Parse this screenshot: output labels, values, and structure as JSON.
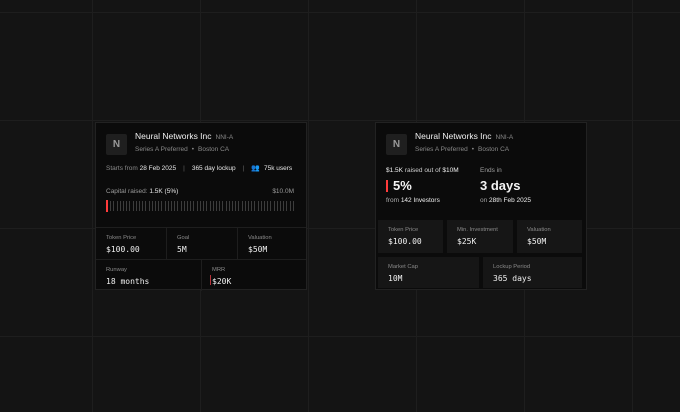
{
  "company": {
    "logo_letter": "N",
    "name": "Neural Networks Inc",
    "ticker": "NNI-A",
    "series": "Series A Preferred",
    "location": "Boston CA"
  },
  "card1": {
    "starts_label": "Starts from",
    "start_date": "28 Feb 2025",
    "lockup": "365 day lockup",
    "users": "75k users",
    "capital_label": "Capital raised:",
    "capital_value": "1.5K (5%)",
    "capital_goal": "$10.0M",
    "progress_percent": 5,
    "metrics_row1": [
      {
        "label": "Token Price",
        "value": "$100.00"
      },
      {
        "label": "Goal",
        "value": "5M"
      },
      {
        "label": "Valuation",
        "value": "$50M"
      }
    ],
    "metrics_row2": [
      {
        "label": "Runway",
        "value": "18 months"
      },
      {
        "label": "MRR",
        "value": "$20K"
      }
    ]
  },
  "card2": {
    "raised_amount": "$1.5K",
    "raised_text": "raised out of",
    "raised_goal": "$10M",
    "percent": "5%",
    "from_text": "from",
    "investors": "142 Investors",
    "ends_label": "Ends in",
    "days": "3 days",
    "on_text": "on",
    "end_date": "28th Feb 2025",
    "metrics_row1": [
      {
        "label": "Token Price",
        "value": "$100.00"
      },
      {
        "label": "Min. Investment",
        "value": "$25K"
      },
      {
        "label": "Valuation",
        "value": "$50M"
      }
    ],
    "metrics_row2": [
      {
        "label": "Market Cap",
        "value": "10M"
      },
      {
        "label": "Lockup Period",
        "value": "365 days"
      }
    ]
  }
}
